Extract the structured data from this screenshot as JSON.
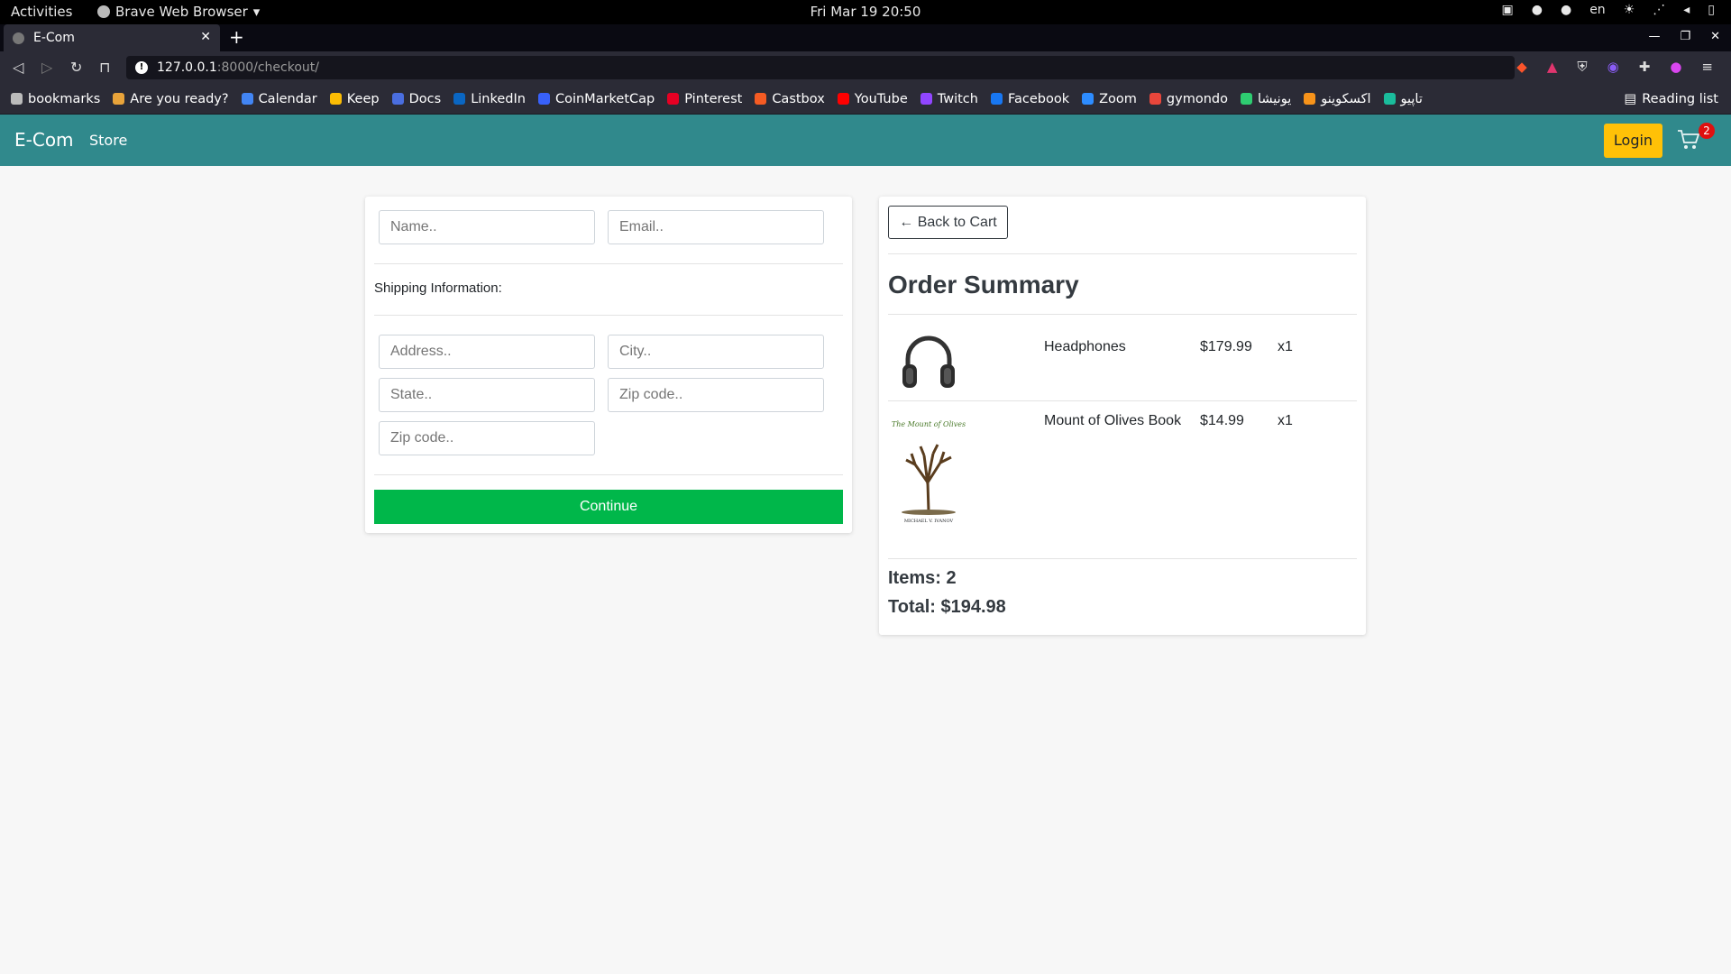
{
  "os": {
    "activities": "Activities",
    "app_name": "Brave Web Browser",
    "clock": "Fri Mar 19  20:50",
    "lang": "en"
  },
  "browser": {
    "tab_title": "E-Com",
    "url_host": "127.0.0.1",
    "url_path": ":8000/checkout/",
    "bookmarks": [
      "bookmarks",
      "Are you ready?",
      "Calendar",
      "Keep",
      "Docs",
      "LinkedIn",
      "CoinMarketCap",
      "Pinterest",
      "Castbox",
      "YouTube",
      "Twitch",
      "Facebook",
      "Zoom",
      "gymondo",
      "یونیشا",
      "اکسکوینو",
      "تاپیو"
    ],
    "reading_list": "Reading list",
    "bookmark_colors": [
      "#bbb",
      "#e8a33a",
      "#4285f4",
      "#fbbc04",
      "#4a6ee0",
      "#0a66c2",
      "#3861fb",
      "#e60023",
      "#f55b23",
      "#ff0000",
      "#9146ff",
      "#1877f2",
      "#2d8cff",
      "#e8463b",
      "#2ecc71",
      "#f7931a",
      "#1abc9c"
    ]
  },
  "navbar": {
    "brand": "E-Com",
    "store": "Store",
    "login": "Login",
    "cart_count": "2"
  },
  "form": {
    "name_placeholder": "Name..",
    "email_placeholder": "Email..",
    "shipping_label": "Shipping Information:",
    "address_placeholder": "Address..",
    "city_placeholder": "City..",
    "state_placeholder": "State..",
    "zip_placeholder": "Zip code..",
    "zip2_placeholder": "Zip code..",
    "continue": "Continue"
  },
  "summary": {
    "back": "← Back to Cart",
    "title": "Order Summary",
    "items": [
      {
        "name": "Headphones",
        "price": "$179.99",
        "qty": "x1"
      },
      {
        "name": "Mount of Olives Book",
        "price": "$14.99",
        "qty": "x1"
      }
    ],
    "book_cover_title": "The Mount of Olives",
    "book_cover_author": "MICHAEL V. IVANOV",
    "items_count": "Items: 2",
    "total": "Total: $194.98"
  }
}
